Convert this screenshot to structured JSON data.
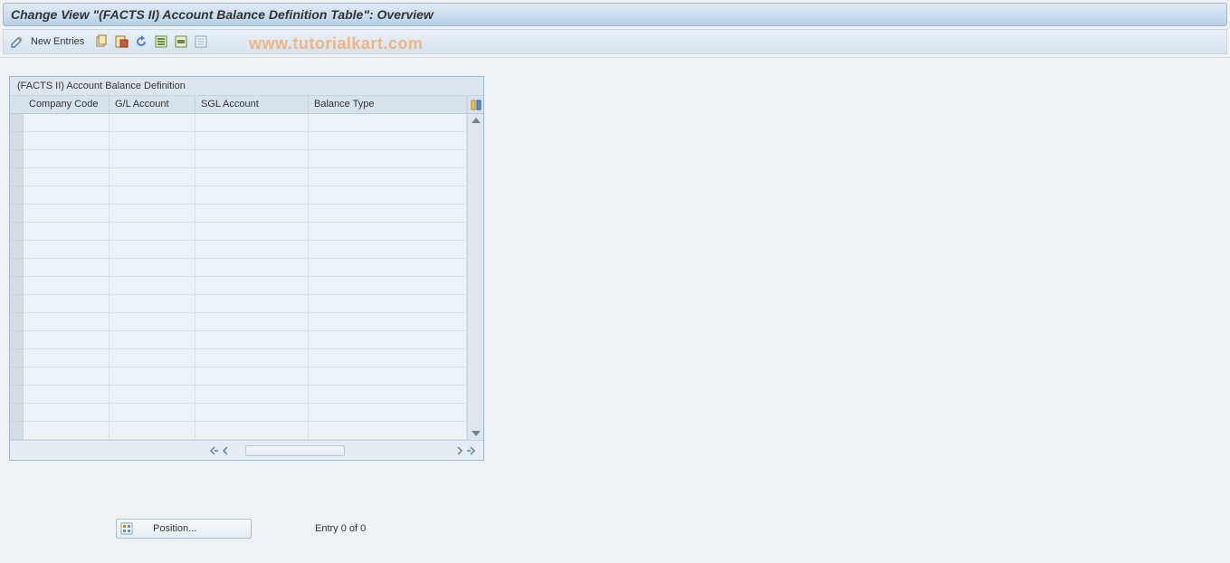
{
  "title": "Change View \"(FACTS II) Account Balance Definition Table\": Overview",
  "watermark": "www.tutorialkart.com",
  "toolbar": {
    "new_entries_label": "New Entries"
  },
  "grid": {
    "caption": "(FACTS II) Account Balance Definition",
    "columns": {
      "company_code": "Company Code",
      "gl_account": "G/L Account",
      "sgl_account": "SGL Account",
      "balance_type": "Balance Type"
    },
    "rows": [
      {
        "company_code": "",
        "gl_account": "",
        "sgl_account": "",
        "balance_type": ""
      },
      {
        "company_code": "",
        "gl_account": "",
        "sgl_account": "",
        "balance_type": ""
      },
      {
        "company_code": "",
        "gl_account": "",
        "sgl_account": "",
        "balance_type": ""
      },
      {
        "company_code": "",
        "gl_account": "",
        "sgl_account": "",
        "balance_type": ""
      },
      {
        "company_code": "",
        "gl_account": "",
        "sgl_account": "",
        "balance_type": ""
      },
      {
        "company_code": "",
        "gl_account": "",
        "sgl_account": "",
        "balance_type": ""
      },
      {
        "company_code": "",
        "gl_account": "",
        "sgl_account": "",
        "balance_type": ""
      },
      {
        "company_code": "",
        "gl_account": "",
        "sgl_account": "",
        "balance_type": ""
      },
      {
        "company_code": "",
        "gl_account": "",
        "sgl_account": "",
        "balance_type": ""
      },
      {
        "company_code": "",
        "gl_account": "",
        "sgl_account": "",
        "balance_type": ""
      },
      {
        "company_code": "",
        "gl_account": "",
        "sgl_account": "",
        "balance_type": ""
      },
      {
        "company_code": "",
        "gl_account": "",
        "sgl_account": "",
        "balance_type": ""
      },
      {
        "company_code": "",
        "gl_account": "",
        "sgl_account": "",
        "balance_type": ""
      },
      {
        "company_code": "",
        "gl_account": "",
        "sgl_account": "",
        "balance_type": ""
      },
      {
        "company_code": "",
        "gl_account": "",
        "sgl_account": "",
        "balance_type": ""
      },
      {
        "company_code": "",
        "gl_account": "",
        "sgl_account": "",
        "balance_type": ""
      },
      {
        "company_code": "",
        "gl_account": "",
        "sgl_account": "",
        "balance_type": ""
      },
      {
        "company_code": "",
        "gl_account": "",
        "sgl_account": "",
        "balance_type": ""
      }
    ]
  },
  "footer": {
    "position_button_label": "Position...",
    "entry_text": "Entry 0 of 0"
  }
}
